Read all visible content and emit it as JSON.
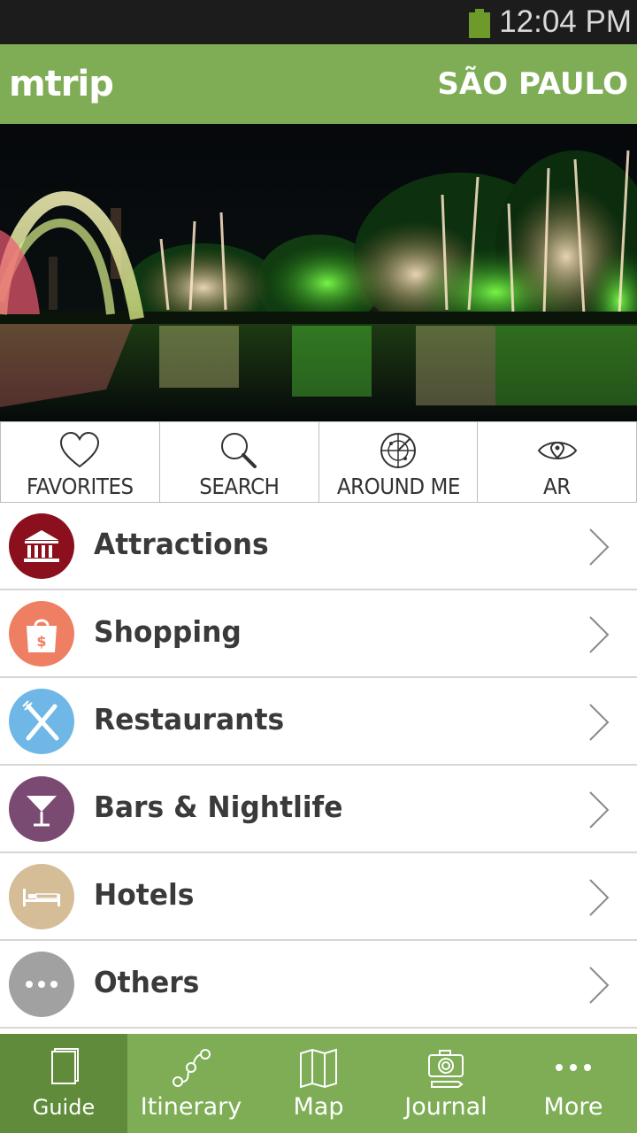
{
  "status_bar": {
    "time": "12:04 PM"
  },
  "header": {
    "logo": "mtrip",
    "city": "SÃO PAULO"
  },
  "hero": {
    "image": "illuminated park fountain and trees reflected in lake at night"
  },
  "quick_actions": [
    {
      "label": "FAVORITES",
      "icon": "heart-icon"
    },
    {
      "label": "SEARCH",
      "icon": "search-icon"
    },
    {
      "label": "AROUND ME",
      "icon": "radar-icon"
    },
    {
      "label": "AR",
      "icon": "eye-icon"
    }
  ],
  "categories": [
    {
      "label": "Attractions",
      "color": "#8b0f1c",
      "icon": "museum-icon"
    },
    {
      "label": "Shopping",
      "color": "#ee7f62",
      "icon": "shopping-bag-icon"
    },
    {
      "label": "Restaurants",
      "color": "#6fb7e6",
      "icon": "cutlery-icon"
    },
    {
      "label": "Bars & Nightlife",
      "color": "#7a4a72",
      "icon": "cocktail-icon"
    },
    {
      "label": "Hotels",
      "color": "#d5bd98",
      "icon": "bed-icon"
    },
    {
      "label": "Others",
      "color": "#a1a1a1",
      "icon": "more-icon"
    }
  ],
  "bottom_nav": [
    {
      "label": "Guide",
      "icon": "book-icon",
      "active": true
    },
    {
      "label": "Itinerary",
      "icon": "route-icon",
      "active": false
    },
    {
      "label": "Map",
      "icon": "map-icon",
      "active": false
    },
    {
      "label": "Journal",
      "icon": "camera-icon",
      "active": false
    },
    {
      "label": "More",
      "icon": "more-dots-icon",
      "active": false
    }
  ],
  "colors": {
    "brand_green": "#7ead56",
    "active_green": "#5f8b3b",
    "status_bar": "#1c1c1c"
  }
}
